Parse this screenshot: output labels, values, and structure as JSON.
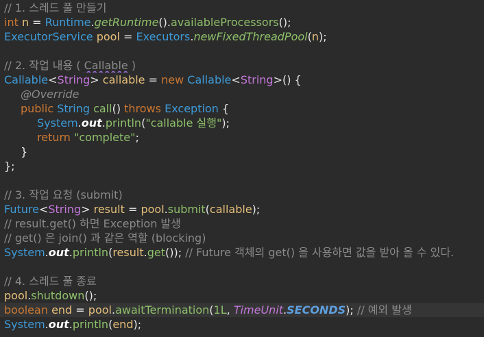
{
  "lines": [
    [
      [
        "t-comment",
        "// 1. 스레드 풀 만들기"
      ]
    ],
    [
      [
        "t-keyword",
        "int"
      ],
      [
        "t-plain",
        " "
      ],
      [
        "t-var",
        "n"
      ],
      [
        "t-op",
        " = "
      ],
      [
        "t-type",
        "Runtime"
      ],
      [
        "t-op",
        "."
      ],
      [
        "t-method-italic",
        "getRuntime"
      ],
      [
        "t-paren",
        "()"
      ],
      [
        "t-op",
        "."
      ],
      [
        "t-method",
        "availableProcessors"
      ],
      [
        "t-paren",
        "();"
      ]
    ],
    [
      [
        "t-type",
        "ExecutorService"
      ],
      [
        "t-plain",
        " "
      ],
      [
        "t-var",
        "pool"
      ],
      [
        "t-op",
        " = "
      ],
      [
        "t-type",
        "Executors"
      ],
      [
        "t-op",
        "."
      ],
      [
        "t-method-italic",
        "newFixedThreadPool"
      ],
      [
        "t-paren",
        "("
      ],
      [
        "t-var",
        "n"
      ],
      [
        "t-paren",
        ");"
      ]
    ],
    [],
    [
      [
        "t-comment",
        "// 2. 작업 내용 ( "
      ],
      [
        "t-comment squiggle",
        "Callable"
      ],
      [
        "t-comment",
        " )"
      ]
    ],
    [
      [
        "t-type",
        "Callable"
      ],
      [
        "t-op",
        "<"
      ],
      [
        "t-generic",
        "String"
      ],
      [
        "t-op",
        "> "
      ],
      [
        "t-var",
        "callable"
      ],
      [
        "t-op",
        " = "
      ],
      [
        "t-keyword",
        "new"
      ],
      [
        "t-plain",
        " "
      ],
      [
        "t-type",
        "Callable"
      ],
      [
        "t-op",
        "<"
      ],
      [
        "t-generic",
        "String"
      ],
      [
        "t-op",
        ">() {"
      ]
    ],
    [
      [
        "t-annotation",
        "@Override"
      ]
    ],
    [
      [
        "t-keyword",
        "public"
      ],
      [
        "t-plain",
        " "
      ],
      [
        "t-type",
        "String"
      ],
      [
        "t-plain",
        " "
      ],
      [
        "t-method",
        "call"
      ],
      [
        "t-paren",
        "() "
      ],
      [
        "t-keyword",
        "throws"
      ],
      [
        "t-plain",
        " "
      ],
      [
        "t-type",
        "Exception"
      ],
      [
        "t-op",
        " {"
      ]
    ],
    [
      [
        "t-type",
        "System"
      ],
      [
        "t-op",
        "."
      ],
      [
        "t-static-field",
        "out"
      ],
      [
        "t-op",
        "."
      ],
      [
        "t-method",
        "println"
      ],
      [
        "t-paren",
        "("
      ],
      [
        "t-string",
        "\"callable 실행\""
      ],
      [
        "t-paren",
        ");"
      ]
    ],
    [
      [
        "t-keyword",
        "return"
      ],
      [
        "t-plain",
        " "
      ],
      [
        "t-string",
        "\"complete\""
      ],
      [
        "t-op",
        ";"
      ]
    ],
    [
      [
        "t-op",
        "}"
      ]
    ],
    [
      [
        "t-op",
        "};"
      ]
    ],
    [],
    [
      [
        "t-comment",
        "// 3. 작업 요청 (submit)"
      ]
    ],
    [
      [
        "t-type",
        "Future"
      ],
      [
        "t-op",
        "<"
      ],
      [
        "t-generic",
        "String"
      ],
      [
        "t-op",
        "> "
      ],
      [
        "t-var",
        "result"
      ],
      [
        "t-op",
        " = "
      ],
      [
        "t-var",
        "pool"
      ],
      [
        "t-op",
        "."
      ],
      [
        "t-method",
        "submit"
      ],
      [
        "t-paren",
        "("
      ],
      [
        "t-var",
        "callable"
      ],
      [
        "t-paren",
        ");"
      ]
    ],
    [
      [
        "t-comment",
        "// result.get() 하면 Exception 발생"
      ]
    ],
    [
      [
        "t-comment",
        "// get() 은 join() 과 같은 역할 (blocking)"
      ]
    ],
    [
      [
        "t-type",
        "System"
      ],
      [
        "t-op",
        "."
      ],
      [
        "t-static-field",
        "out"
      ],
      [
        "t-op",
        "."
      ],
      [
        "t-method",
        "println"
      ],
      [
        "t-paren",
        "("
      ],
      [
        "t-var",
        "result"
      ],
      [
        "t-op",
        "."
      ],
      [
        "t-method",
        "get"
      ],
      [
        "t-paren",
        "()); "
      ],
      [
        "t-comment",
        "// Future 객체의 get() 을 사용하면 값을 받아 올 수 있다."
      ]
    ],
    [],
    [
      [
        "t-comment",
        "// 4. 스레드 풀 종료"
      ]
    ],
    [
      [
        "t-var",
        "pool"
      ],
      [
        "t-op",
        "."
      ],
      [
        "t-method",
        "shutdown"
      ],
      [
        "t-paren",
        "();"
      ]
    ],
    [
      [
        "t-keyword",
        "boolean"
      ],
      [
        "t-plain",
        " "
      ],
      [
        "t-var",
        "end"
      ],
      [
        "t-op",
        " = "
      ],
      [
        "t-var",
        "pool"
      ],
      [
        "t-op",
        "."
      ],
      [
        "t-method",
        "awaitTermination"
      ],
      [
        "t-paren",
        "("
      ],
      [
        "t-number",
        "1L"
      ],
      [
        "t-op",
        ", "
      ],
      [
        "t-enum-type",
        "TimeUnit"
      ],
      [
        "t-op",
        "."
      ],
      [
        "t-static-const",
        "SECONDS"
      ],
      [
        "t-paren",
        "); "
      ],
      [
        "t-comment",
        "// 예외 발생"
      ]
    ],
    [
      [
        "t-type",
        "System"
      ],
      [
        "t-op",
        "."
      ],
      [
        "t-static-field",
        "out"
      ],
      [
        "t-op",
        "."
      ],
      [
        "t-method",
        "println"
      ],
      [
        "t-paren",
        "("
      ],
      [
        "t-var",
        "end"
      ],
      [
        "t-paren",
        ");"
      ]
    ]
  ],
  "colors": {
    "background": "#2b2b2b",
    "current_line": "#353535",
    "comment": "#8a8a8a",
    "keyword": "#cc7832",
    "type": "#3d9bd9",
    "generic": "#c477db",
    "method": "#8ec06a",
    "variable": "#e6c07b"
  }
}
